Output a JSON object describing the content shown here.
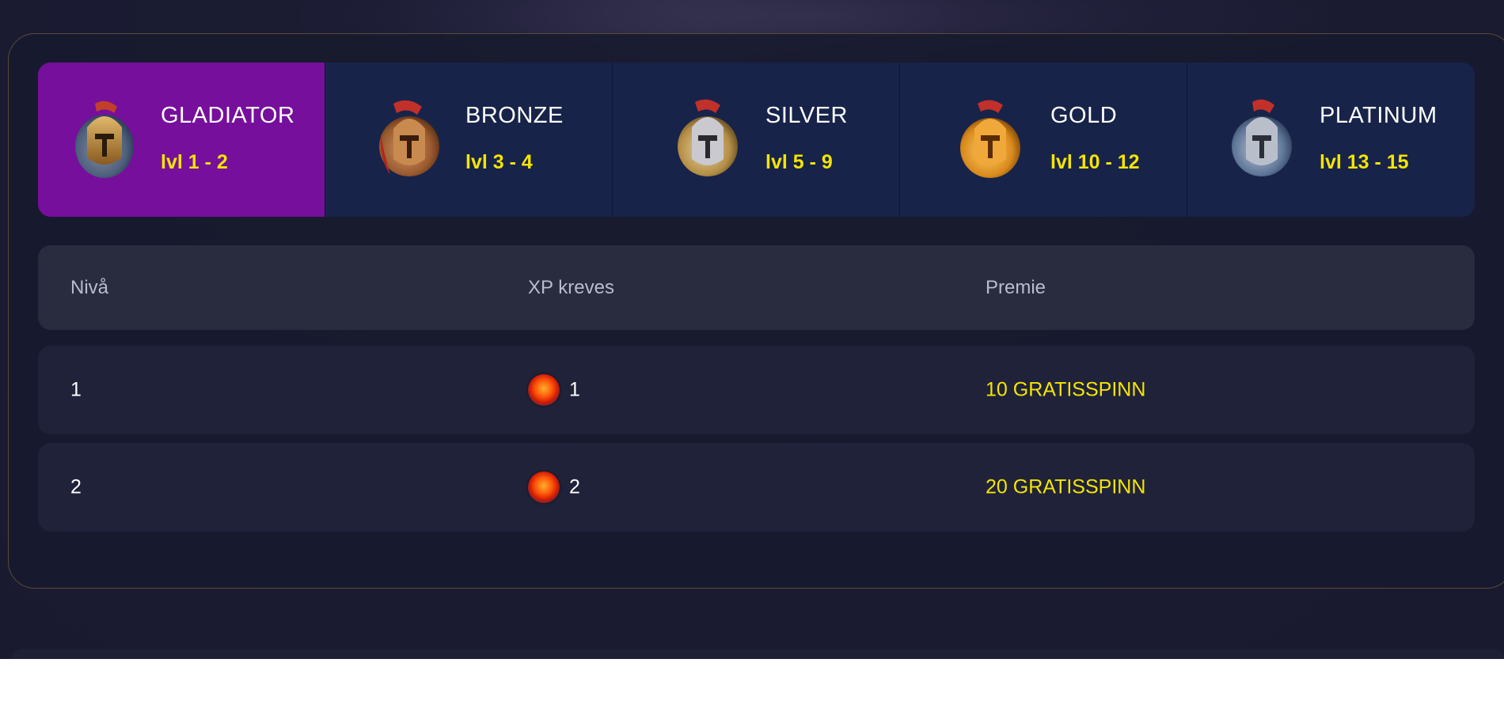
{
  "tiers": [
    {
      "name": "GLADIATOR",
      "levels": "lvl 1 - 2",
      "active": true,
      "icon": "gladiator-helmet-icon"
    },
    {
      "name": "BRONZE",
      "levels": "lvl 3 - 4",
      "active": false,
      "icon": "bronze-helmet-icon"
    },
    {
      "name": "SILVER",
      "levels": "lvl 5 - 9",
      "active": false,
      "icon": "silver-helmet-icon"
    },
    {
      "name": "GOLD",
      "levels": "lvl 10 - 12",
      "active": false,
      "icon": "gold-helmet-icon"
    },
    {
      "name": "PLATINUM",
      "levels": "lvl 13 - 15",
      "active": false,
      "icon": "platinum-helmet-icon"
    }
  ],
  "table": {
    "headers": {
      "level": "Nivå",
      "xp": "XP kreves",
      "prize": "Premie"
    },
    "rows": [
      {
        "level": "1",
        "xp": "1",
        "prize": "10 GRATISSPINN"
      },
      {
        "level": "2",
        "xp": "2",
        "prize": "20 GRATISSPINN"
      }
    ]
  },
  "colors": {
    "active_tier": "#760f9c",
    "tier_bg": "#18234a",
    "level_text": "#f4e500",
    "prize_text": "#f4e500"
  }
}
